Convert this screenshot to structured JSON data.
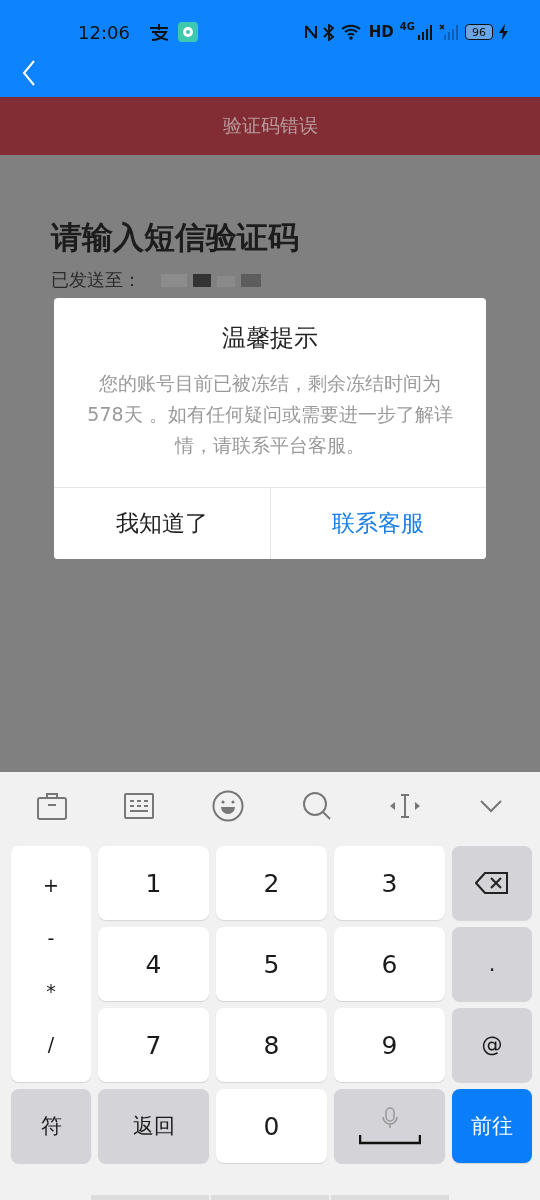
{
  "status_bar": {
    "time": "12:06",
    "hd_label": "HD",
    "network_label": "4G",
    "battery": "96"
  },
  "toast": {
    "text": "验证码错误"
  },
  "page": {
    "title": "请输入短信验证码",
    "sent_to_label": "已发送至："
  },
  "dialog": {
    "title": "温馨提示",
    "message": "您的账号目前已被冻结，剩余冻结时间为 578天 。如有任何疑问或需要进一步了解详情，请联系平台客服。",
    "buttons": [
      {
        "label": "我知道了",
        "kind": "default"
      },
      {
        "label": "联系客服",
        "kind": "primary"
      }
    ]
  },
  "keyboard": {
    "symbol_keys": [
      "+",
      "-",
      "*",
      "/"
    ],
    "keys": [
      {
        "label": "1",
        "kind": "digit"
      },
      {
        "label": "2",
        "kind": "digit"
      },
      {
        "label": "3",
        "kind": "digit"
      },
      {
        "kind": "backspace"
      },
      {
        "label": "4",
        "kind": "digit"
      },
      {
        "label": "5",
        "kind": "digit"
      },
      {
        "label": "6",
        "kind": "digit"
      },
      {
        "label": ".",
        "kind": "function"
      },
      {
        "label": "7",
        "kind": "digit"
      },
      {
        "label": "8",
        "kind": "digit"
      },
      {
        "label": "9",
        "kind": "digit"
      },
      {
        "label": "@",
        "kind": "function"
      },
      {
        "label": "符",
        "kind": "function"
      },
      {
        "label": "返回",
        "kind": "function"
      },
      {
        "label": "0",
        "kind": "digit"
      },
      {
        "kind": "space"
      },
      {
        "label": "前往",
        "kind": "primary"
      }
    ]
  }
}
